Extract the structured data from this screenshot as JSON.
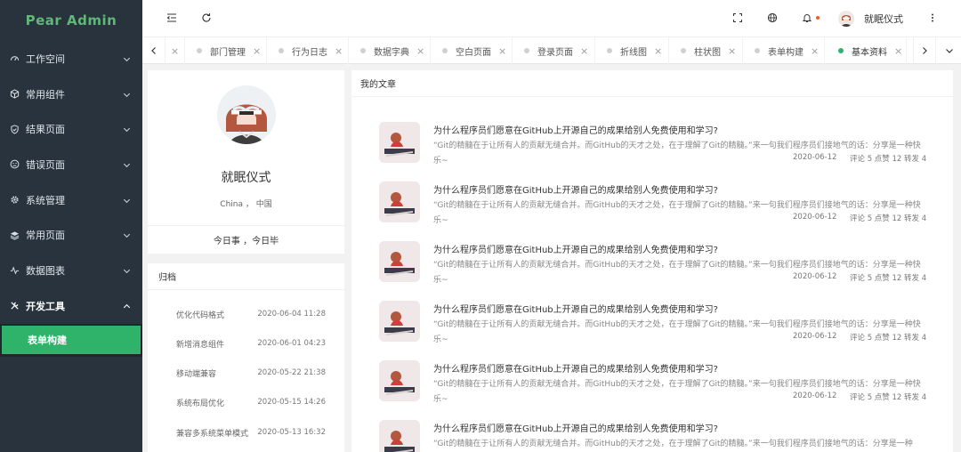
{
  "brand": {
    "name": "Pear Admin",
    "color": "#5fb878"
  },
  "sidebar": {
    "items": [
      {
        "label": "工作空间",
        "icon": "dashboard-icon"
      },
      {
        "label": "常用组件",
        "icon": "cube-icon"
      },
      {
        "label": "结果页面",
        "icon": "shield-check-icon"
      },
      {
        "label": "错误页面",
        "icon": "face-sad-icon"
      },
      {
        "label": "系统管理",
        "icon": "gear-icon"
      },
      {
        "label": "常用页面",
        "icon": "layers-icon"
      },
      {
        "label": "数据图表",
        "icon": "chart-line-icon"
      },
      {
        "label": "开发工具",
        "icon": "tools-icon"
      }
    ],
    "active_sub": "表单构建"
  },
  "header": {
    "icons": [
      "menu-collapse-icon",
      "refresh-icon",
      "fullscreen-icon",
      "globe-icon",
      "bell-icon",
      "more-icon"
    ],
    "username": "就眠仪式"
  },
  "tabs": {
    "items": [
      "部门管理",
      "行为日志",
      "数据字典",
      "空白页面",
      "登录页面",
      "折线图",
      "柱状图",
      "表单构建",
      "基本资料"
    ],
    "active": "基本资料",
    "close_glyph": "×"
  },
  "profile": {
    "name": "就眠仪式",
    "location": "China ， 中国",
    "motto": "今日事 ，今日毕"
  },
  "archive": {
    "title": "归档",
    "items": [
      {
        "name": "优化代码格式",
        "date": "2020-06-04 11:28"
      },
      {
        "name": "新增消息组件",
        "date": "2020-06-01 04:23"
      },
      {
        "name": "移动端兼容",
        "date": "2020-05-22 21:38"
      },
      {
        "name": "系统布局优化",
        "date": "2020-05-15 14:26"
      },
      {
        "name": "兼容多系统菜单模式",
        "date": "2020-05-13 16:32"
      }
    ]
  },
  "articles": {
    "title": "我的文章",
    "items": [
      {
        "title": "为什么程序员们愿意在GitHub上开源自己的成果给别人免费使用和学习?",
        "desc": "“Git的精髓在于让所有人的贡献无缝合并。而GitHub的天才之处，在于理解了Git的精髓。”来一句我们程序员们接地气的话：分享是一种快乐~",
        "date": "2020-06-12",
        "meta": "评论 5 点赞 12 转发 4"
      },
      {
        "title": "为什么程序员们愿意在GitHub上开源自己的成果给别人免费使用和学习?",
        "desc": "“Git的精髓在于让所有人的贡献无缝合并。而GitHub的天才之处，在于理解了Git的精髓。”来一句我们程序员们接地气的话：分享是一种快乐~",
        "date": "2020-06-12",
        "meta": "评论 5 点赞 12 转发 4"
      },
      {
        "title": "为什么程序员们愿意在GitHub上开源自己的成果给别人免费使用和学习?",
        "desc": "“Git的精髓在于让所有人的贡献无缝合并。而GitHub的天才之处，在于理解了Git的精髓。”来一句我们程序员们接地气的话：分享是一种快乐~",
        "date": "2020-06-12",
        "meta": "评论 5 点赞 12 转发 4"
      },
      {
        "title": "为什么程序员们愿意在GitHub上开源自己的成果给别人免费使用和学习?",
        "desc": "“Git的精髓在于让所有人的贡献无缝合并。而GitHub的天才之处，在于理解了Git的精髓。”来一句我们程序员们接地气的话：分享是一种快乐~",
        "date": "2020-06-12",
        "meta": "评论 5 点赞 12 转发 4"
      },
      {
        "title": "为什么程序员们愿意在GitHub上开源自己的成果给别人免费使用和学习?",
        "desc": "“Git的精髓在于让所有人的贡献无缝合并。而GitHub的天才之处，在于理解了Git的精髓。”来一句我们程序员们接地气的话：分享是一种快乐~",
        "date": "2020-06-12",
        "meta": "评论 5 点赞 12 转发 4"
      },
      {
        "title": "为什么程序员们愿意在GitHub上开源自己的成果给别人免费使用和学习?",
        "desc": "“Git的精髓在于让所有人的贡献无缝合并。而GitHub的天才之处，在于理解了Git的精髓。”来一句我们程序员们接地气的话：分享是一种",
        "date": "",
        "meta": ""
      }
    ]
  },
  "colors": {
    "sidebar_bg": "#28333e",
    "accent": "#2fb36a",
    "notify": "#ff5722"
  }
}
